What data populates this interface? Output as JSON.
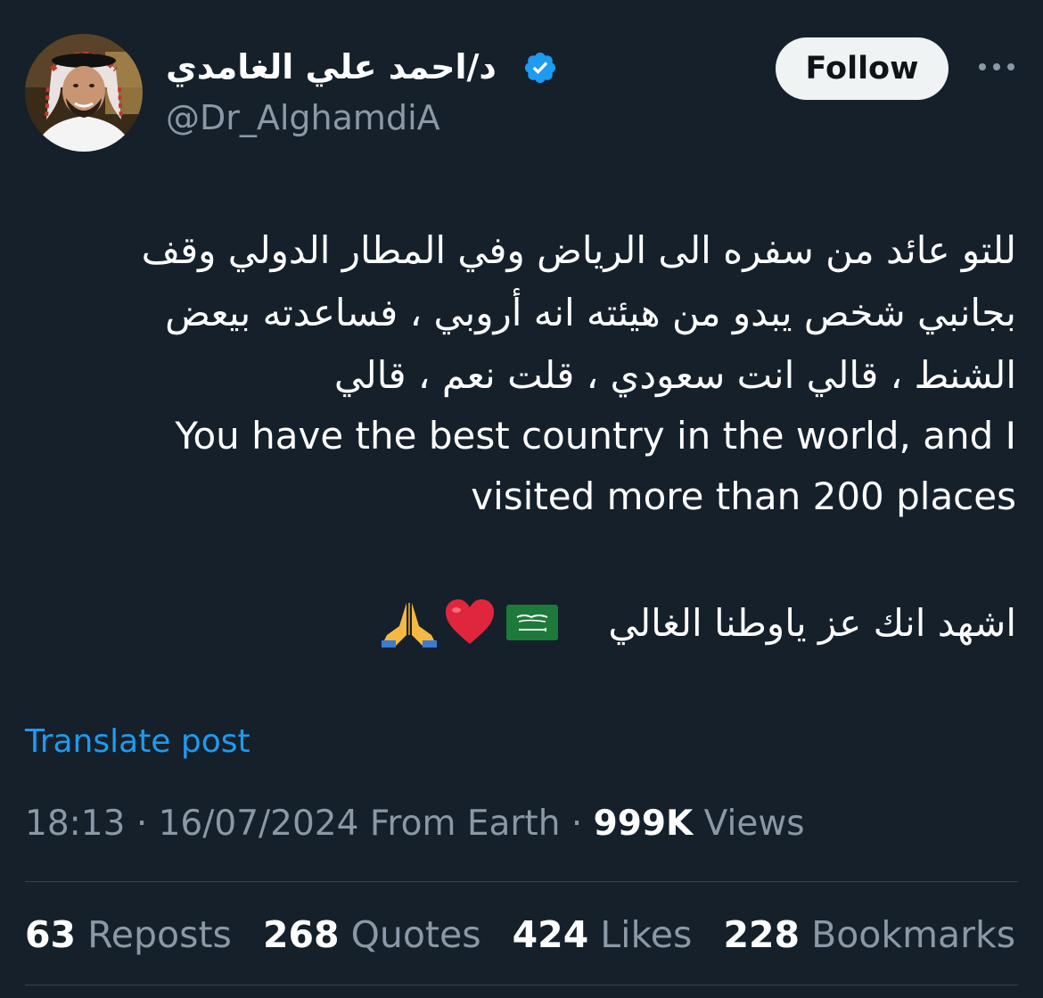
{
  "author": {
    "display_name": "د/احمد علي الغامدي",
    "handle": "@Dr_AlghamdiA",
    "verified": true,
    "verified_color": "#1d9bf0"
  },
  "actions": {
    "follow_label": "Follow",
    "more_icon": "more-horizontal-icon"
  },
  "tweet": {
    "lines": [
      "للتو عائد من سفره الى الرياض وفي المطار الدولي وقف",
      "بجانبي شخص يبدو من هيئته انه أروبي ، فساعدته بيعض",
      "الشنط ، قالي انت سعودي ، قلت نعم ، قالي",
      "You have the best country in the world, and I",
      "visited more than 200 places"
    ],
    "closing_line": "اشهد انك عز ياوطنا الغالي",
    "emojis": [
      "saudi-flag-icon",
      "red-heart-icon",
      "folded-hands-icon"
    ]
  },
  "translate_label": "Translate post",
  "meta": {
    "time": "18:13",
    "date": "16/07/2024",
    "source": "From Earth",
    "views_count": "999K",
    "views_label": "Views"
  },
  "stats": {
    "reposts_count": "63",
    "reposts_label": "Reposts",
    "quotes_count": "268",
    "quotes_label": "Quotes",
    "likes_count": "424",
    "likes_label": "Likes",
    "bookmarks_count": "228",
    "bookmarks_label": "Bookmarks"
  },
  "colors": {
    "background": "#15202b",
    "text": "#ffffff",
    "secondary_text": "#8b98a5",
    "link": "#1d9bf0",
    "divider": "#38444d",
    "follow_button": "#eff3f4"
  }
}
